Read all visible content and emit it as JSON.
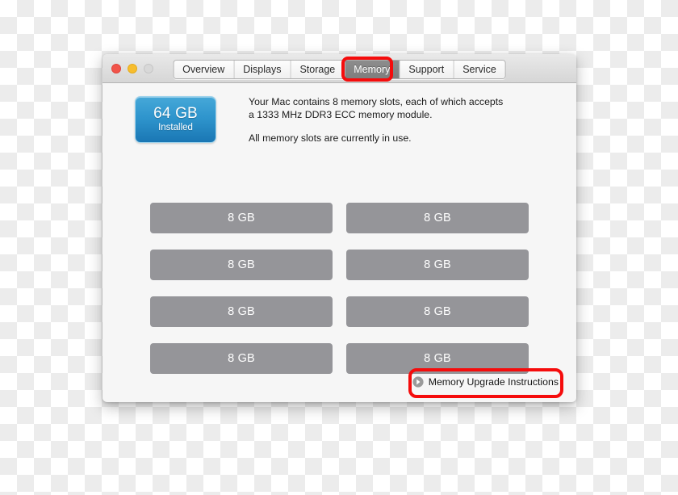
{
  "window": {
    "traffic_lights": [
      {
        "name": "close",
        "color": "#f1544a"
      },
      {
        "name": "minimize",
        "color": "#f7bd2e"
      },
      {
        "name": "zoom",
        "color": "#d8d8d8"
      }
    ],
    "tabs": [
      {
        "label": "Overview",
        "selected": false
      },
      {
        "label": "Displays",
        "selected": false
      },
      {
        "label": "Storage",
        "selected": false
      },
      {
        "label": "Memory",
        "selected": true
      },
      {
        "label": "Support",
        "selected": false
      },
      {
        "label": "Service",
        "selected": false
      }
    ]
  },
  "memory": {
    "badge": {
      "size": "64 GB",
      "state": "Installed",
      "color": "#2f95cd"
    },
    "description_line1": "Your Mac contains 8 memory slots, each of which accepts",
    "description_line2": "a 1333 MHz DDR3 ECC memory module.",
    "description_line3": "All memory slots are currently in use.",
    "slots": [
      {
        "capacity": "8 GB"
      },
      {
        "capacity": "8 GB"
      },
      {
        "capacity": "8 GB"
      },
      {
        "capacity": "8 GB"
      },
      {
        "capacity": "8 GB"
      },
      {
        "capacity": "8 GB"
      },
      {
        "capacity": "8 GB"
      },
      {
        "capacity": "8 GB"
      }
    ],
    "upgrade_link": {
      "label": "Memory Upgrade Instructions",
      "icon": "arrow-right-circle-icon"
    }
  },
  "annotations": {
    "color": "#f50c0c",
    "items": [
      {
        "target": "Memory tab"
      },
      {
        "target": "Memory Upgrade Instructions link"
      }
    ]
  }
}
